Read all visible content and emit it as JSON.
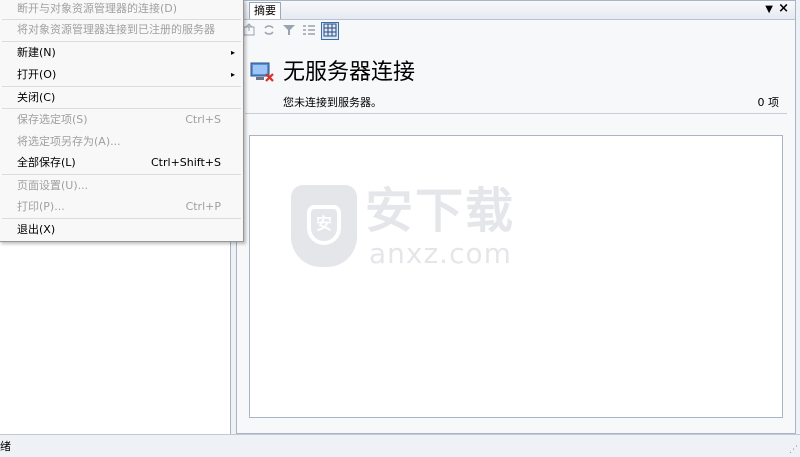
{
  "colors": {
    "accent": "#3a6ea5",
    "menu_background": "#f8f8f8",
    "disabled_text": "#a0a0a0",
    "pane_border": "#a9b4c4"
  },
  "file_menu": {
    "items": [
      {
        "label": "断开与对象资源管理器的连接(D)",
        "shortcut": "",
        "disabled": true
      },
      {
        "label": "将对象资源管理器连接到已注册的服务器",
        "shortcut": "",
        "disabled": true
      },
      {
        "label": "新建(N)",
        "shortcut": "",
        "disabled": false,
        "submenu": "▸"
      },
      {
        "label": "打开(O)",
        "shortcut": "",
        "disabled": false,
        "submenu": "▸"
      },
      {
        "label": "关闭(C)",
        "shortcut": "",
        "disabled": false
      },
      {
        "label": "保存选定项(S)",
        "shortcut": "Ctrl+S",
        "disabled": true
      },
      {
        "label": "将选定项另存为(A)...",
        "shortcut": "",
        "disabled": true
      },
      {
        "label": "全部保存(L)",
        "shortcut": "Ctrl+Shift+S",
        "disabled": false
      },
      {
        "label": "页面设置(U)...",
        "shortcut": "",
        "disabled": true
      },
      {
        "label": "打印(P)...",
        "shortcut": "Ctrl+P",
        "disabled": true
      },
      {
        "label": "退出(X)",
        "shortcut": "",
        "disabled": false
      }
    ]
  },
  "summary_panel": {
    "tab_label": "摘要",
    "dropdown_glyph": "▼",
    "close_glyph": "×",
    "title": "无服务器连接",
    "message": "您未连接到服务器。",
    "item_count": "0 项",
    "toolbar_icons": [
      "upload-icon",
      "sync-icon",
      "filter-icon",
      "list-view-icon",
      "details-view-icon"
    ]
  },
  "watermark": {
    "shield_glyph": "安",
    "cn_text": "安下载",
    "domain": "anxz.com"
  },
  "status_bar": {
    "text": "绪",
    "grip": "⋰"
  }
}
